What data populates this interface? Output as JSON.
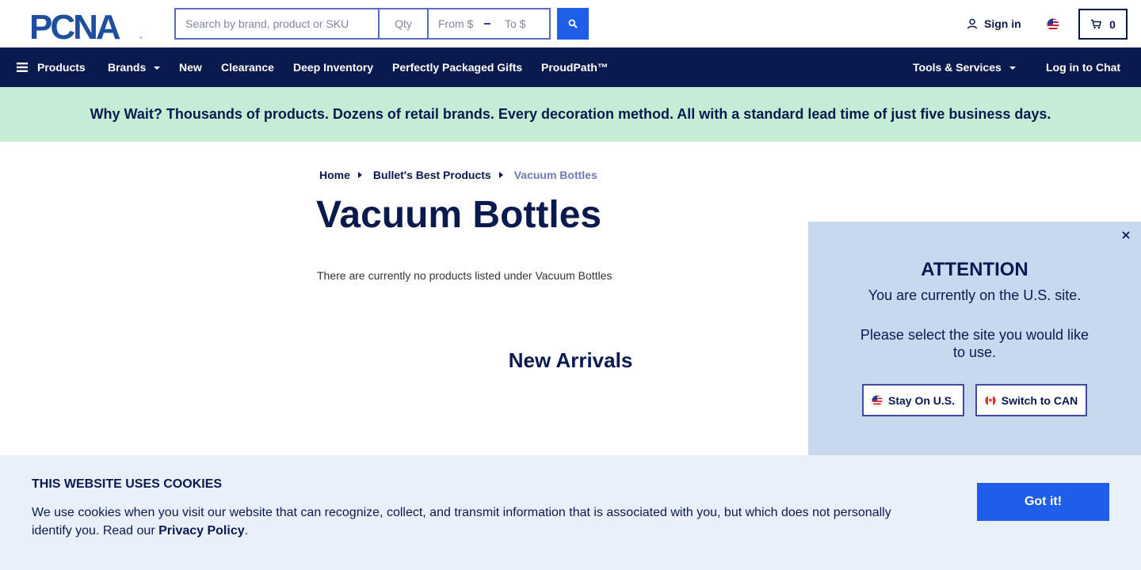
{
  "header": {
    "logo_text": "PCNA",
    "search": {
      "placeholder": "Search by brand, product or SKU",
      "value": ""
    },
    "qty": {
      "placeholder": "Qty"
    },
    "price_from": {
      "placeholder": "From $"
    },
    "price_to": {
      "placeholder": "To $"
    },
    "signin_label": "Sign in",
    "cart_count": "0",
    "icons": {
      "search": "search-icon",
      "user": "user-icon",
      "flag": "us-flag-icon",
      "cart": "cart-icon"
    }
  },
  "nav": {
    "items": [
      {
        "label": "Products",
        "icon": "hamburger-icon"
      },
      {
        "label": "Brands",
        "dropdown": true
      },
      {
        "label": "New"
      },
      {
        "label": "Clearance"
      },
      {
        "label": "Deep Inventory"
      },
      {
        "label": "Perfectly Packaged Gifts"
      },
      {
        "label": "ProudPath™"
      },
      {
        "label": "Tools & Services",
        "dropdown": true
      },
      {
        "label": "Log in to Chat"
      }
    ]
  },
  "banner": {
    "text": "Why Wait? Thousands of products. Dozens of retail brands. Every decoration method. All with a standard lead time of just five business days."
  },
  "breadcrumb": {
    "items": [
      "Home",
      "Bullet's Best Products",
      "Vacuum Bottles"
    ]
  },
  "main": {
    "title": "Vacuum Bottles",
    "empty_message": "There are currently no products listed under Vacuum Bottles",
    "new_arrivals_heading": "New Arrivals"
  },
  "popup": {
    "title": "ATTENTION",
    "line1": "You are currently on the U.S. site.",
    "line2": "Please select the site you would like to use.",
    "stay_label": "Stay On U.S.",
    "switch_label": "Switch to CAN"
  },
  "cookie": {
    "title": "THIS WEBSITE USES COOKIES",
    "text": "We use cookies when you visit our website that can recognize, collect, and transmit information that is associated with you, but which does not personally identify you. Read our ",
    "link_label": "Privacy Policy",
    "text_end": ".",
    "button_label": "Got it!"
  },
  "colors": {
    "navy": "#0a1a4f",
    "accent_blue": "#1e5ee8",
    "banner_green": "#c5edd6",
    "popup_bg": "#c8d8ee",
    "cookie_bg": "#e9f0f9"
  }
}
